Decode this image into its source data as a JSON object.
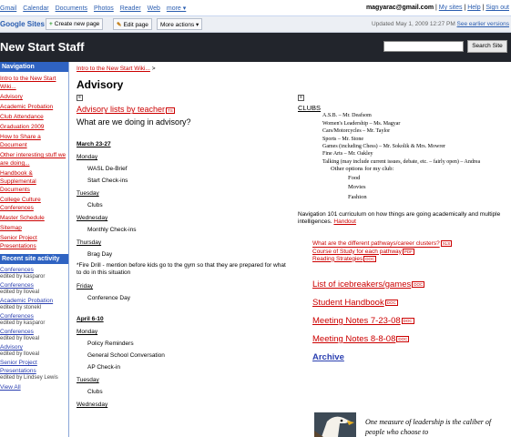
{
  "gbar": {
    "links": [
      "Gmail",
      "Calendar",
      "Documents",
      "Photos",
      "Reader",
      "Web",
      "more ▾"
    ],
    "email": "magyarac@gmail.com",
    "my_sites": "My sites",
    "help": "Help",
    "sign_out": "Sign out"
  },
  "sitesbar": {
    "logo": "Google Sites",
    "create_page": "Create new page",
    "edit_page": "Edit page",
    "more_actions": "More actions ▾",
    "updated": "Updated May 1, 2009 12:27 PM",
    "earlier_versions": "See earlier versions"
  },
  "header": {
    "site_title": "New Start Staff",
    "search_value": "",
    "search_button": "Search Site"
  },
  "sidebar": {
    "nav_heading": "Navigation",
    "nav_items": [
      "Intro to the New Start Wiki...",
      "Advisory",
      "Academic Probation",
      "Club Attendance",
      "Graduation 2009",
      "How to Share a Document",
      "Other interesting stuff we are doing...",
      "Handbook & Supplemental Documents",
      "College Culture Conferences",
      "Master Schedule",
      "Sitemap",
      "Senior Project Presentations"
    ],
    "activity_heading": "Recent site activity",
    "activity": [
      {
        "title": "Conferences",
        "by": "edited by kasparor"
      },
      {
        "title": "Conferences",
        "by": "edited by lloveal"
      },
      {
        "title": "Academic Probation",
        "by": "edited by stonekl"
      },
      {
        "title": "Conferences",
        "by": "edited by kasparor"
      },
      {
        "title": "Conferences",
        "by": "edited by lloveal"
      },
      {
        "title": "Advisory",
        "by": "edited by lloveal"
      },
      {
        "title": "Senior Project Presentations",
        "by": "edited by Lindsey Lewis"
      }
    ],
    "view_all": "View All"
  },
  "main": {
    "breadcrumb": "Intro to the New Start Wiki...",
    "breadcrumb_sep": " >",
    "page_title": "Advisory",
    "left": {
      "advisory_link": "Advisory lists by teacher",
      "advisory_link_tag": "TS",
      "question": "What are we doing in advisory?",
      "week1": "March 23-27",
      "monday": "Monday",
      "m_act1": "WASL De-Brief",
      "m_act2": "Start Check-ins",
      "tuesday": "Tuesday",
      "t_act": "Clubs",
      "wednesday": "Wednesday",
      "w_act": "Monthly Check-ins",
      "thursday": "Thursday",
      "th_act": "Brag Day",
      "th_note": "*Fire Drill - mention before kids go to the gym so that they are prepared for what to do in this situation",
      "friday": "Friday",
      "f_act": "Conference Day",
      "week2": "April 6-10",
      "monday2": "Monday",
      "m2_act1": "Policy Reminders",
      "m2_act2": "General School Conversation",
      "m2_act3": "AP Check-in",
      "tuesday2": "Tuesday",
      "t2_act": "Clubs",
      "wednesday2": "Wednesday"
    },
    "right": {
      "clubs_heading": "CLUBS",
      "clubs": [
        "A.S.B. – Mr. Deafsom",
        "Women's Leadership – Ms. Magyar",
        "Cars/Motorcycles – Mr. Taylor",
        "Sports – Mr. Stone",
        "Games (including Chess) – Mr. Sokolik & Mrs. Mowrer",
        "Fine Arts – Mr. Oakley",
        "Talking (may include current issues, debate, etc. – fairly open) – Andrea"
      ],
      "other_options": "Other options for my club:",
      "sub_options": [
        "Food",
        "Movies",
        "Fashion"
      ],
      "nav_text": "Navigation 101 curriculum on how things are going academically and multiple intelligences.",
      "handout": "Handout",
      "small_links": [
        {
          "text": "What are the different pathways/career clusters?",
          "tag": "XLS"
        },
        {
          "text": "Course of Study for each pathway",
          "tag": "PDF"
        },
        {
          "text": "Reading Strategies",
          "tag": "DOC"
        }
      ],
      "big_links": [
        {
          "text": "List of icebreakers/games",
          "tag": "DOC"
        },
        {
          "text": "Student Handbook",
          "tag": "DOC"
        },
        {
          "text": "Meeting Notes 7-23-08",
          "tag": "DOC"
        },
        {
          "text": "Meeting Notes 8-8-08",
          "tag": "DOC"
        }
      ],
      "archive": "Archive",
      "quote": "One measure of leadership is the caliber of people who choose to"
    }
  },
  "colors": {
    "link_red": "#cc0000",
    "header_bg": "#22252c",
    "sidebar_heading": "#2f63c2"
  }
}
